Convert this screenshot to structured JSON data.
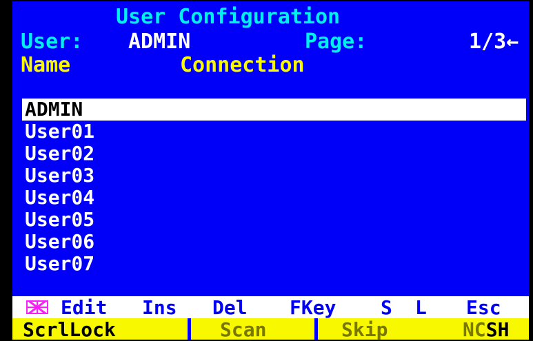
{
  "header": {
    "title": "User Configuration",
    "user_label": "User:",
    "user_value": "ADMIN",
    "page_label": "Page:",
    "page_value": "1/3",
    "page_arrow": "←"
  },
  "columns": {
    "name": "Name",
    "connection": "Connection"
  },
  "users": [
    "ADMIN",
    "User01",
    "User02",
    "User03",
    "User04",
    "User05",
    "User06",
    "User07"
  ],
  "selected_user": "ADMIN",
  "hotkeys": {
    "icon": "keyboard-icon",
    "edit": "Edit",
    "ins": "Ins",
    "del": "Del",
    "fkey": "FKey",
    "s": "S",
    "l": "L",
    "esc": "Esc"
  },
  "status": {
    "scroll_lock": "ScrlLock",
    "scan": "Scan",
    "skip": "Skip",
    "ncsh_prefix": "NC",
    "ncsh_suffix": "SH"
  },
  "colors": {
    "osd_background": "#0000f8",
    "title_text": "#00f0f0",
    "value_text": "#ffffff",
    "column_header_text": "#f8f800",
    "selection_background": "#ffffff",
    "hotkey_icon": "#f820f8",
    "status_active": "#000000",
    "status_inactive": "#787800"
  }
}
